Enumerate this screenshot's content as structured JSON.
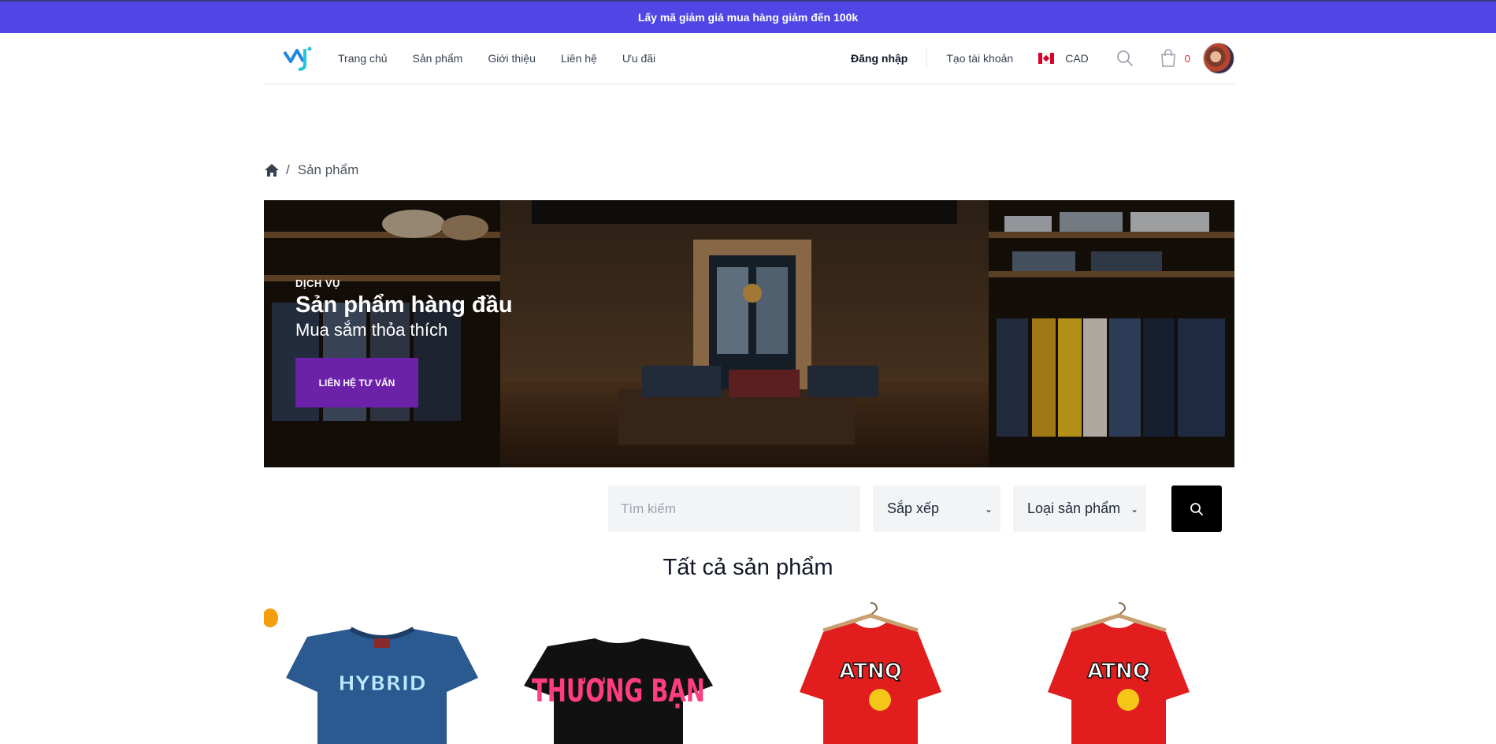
{
  "promo": {
    "text": "Lấy mã giảm giá mua hàng giảm đến 100k"
  },
  "nav": {
    "items": [
      "Trang chủ",
      "Sản phẩm",
      "Giới thiệu",
      "Liên hệ",
      "Ưu đãi"
    ],
    "login": "Đăng nhập",
    "register": "Tạo tài khoản",
    "currency": "CAD",
    "cart_count": "0"
  },
  "breadcrumb": {
    "current": "Sản phẩm",
    "separator": "/"
  },
  "hero": {
    "kicker": "DỊCH VỤ",
    "title": "Sản phẩm hàng đầu",
    "subtitle": "Mua sắm thỏa thích",
    "button": "LIÊN HỆ TƯ VẤN"
  },
  "filters": {
    "search_placeholder": "Tìm kiếm",
    "sort_label": "Sắp xếp",
    "type_label": "Loại sản phẩm"
  },
  "section": {
    "title": "Tất cả sản phẩm"
  },
  "products": [
    {
      "shirt_text": "HYBRID",
      "color": "#2a5a8f"
    },
    {
      "shirt_text": "THƯƠNG BẠN",
      "color": "#111111"
    },
    {
      "shirt_text": "ATNQ",
      "color": "#e11d1d"
    },
    {
      "shirt_text": "ATNQ",
      "color": "#e11d1d"
    }
  ],
  "colors": {
    "promo_bg": "#4f46e5",
    "hero_button": "#6b21a8",
    "cart_count": "#dc2626"
  }
}
